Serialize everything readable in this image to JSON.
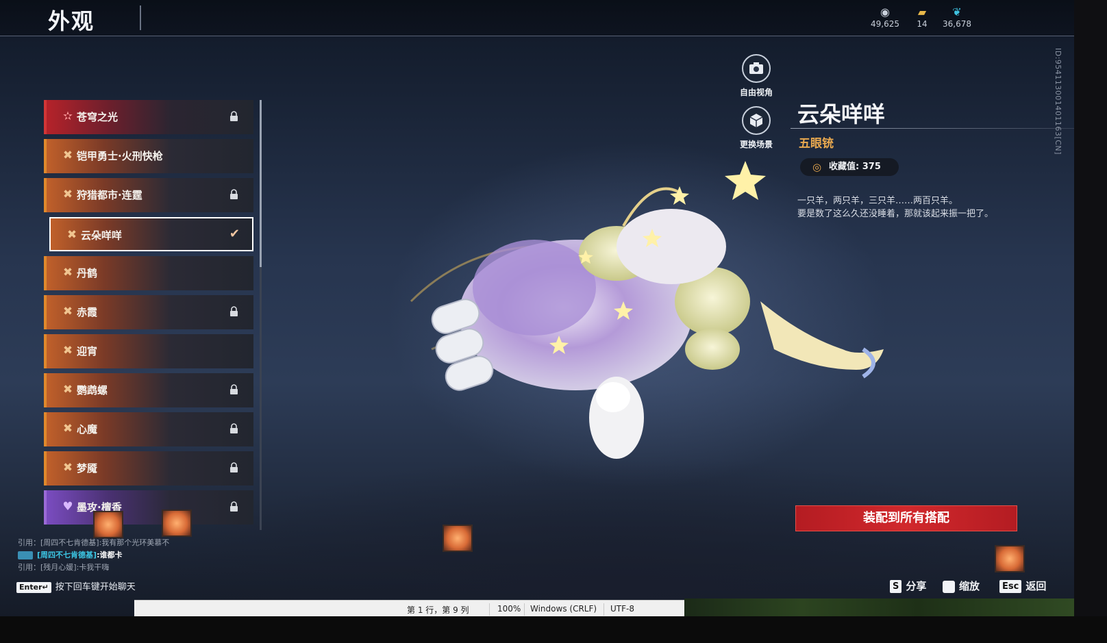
{
  "header": {
    "title": "外观",
    "currencies": [
      {
        "icon": "coin-stack-icon",
        "value": "49,625"
      },
      {
        "icon": "ticket-icon",
        "value": "14"
      },
      {
        "icon": "feather-icon",
        "value": "36,678"
      }
    ],
    "id_text": "ID:954113001401163[CN]"
  },
  "skin_list": [
    {
      "label": "苍穹之光",
      "rarity": "red",
      "locked": true,
      "selected": false
    },
    {
      "label": "铠甲勇士·火刑快枪",
      "rarity": "orange",
      "locked": false,
      "selected": false
    },
    {
      "label": "狩猎都市·连霆",
      "rarity": "orange",
      "locked": true,
      "selected": false
    },
    {
      "label": "云朵咩咩",
      "rarity": "orange",
      "locked": false,
      "selected": true
    },
    {
      "label": "丹鹤",
      "rarity": "orange",
      "locked": false,
      "selected": false
    },
    {
      "label": "赤霞",
      "rarity": "orange",
      "locked": true,
      "selected": false
    },
    {
      "label": "迎宵",
      "rarity": "orange",
      "locked": false,
      "selected": false
    },
    {
      "label": "鹦鹉螺",
      "rarity": "orange",
      "locked": true,
      "selected": false
    },
    {
      "label": "心魔",
      "rarity": "orange",
      "locked": true,
      "selected": false
    },
    {
      "label": "梦魇",
      "rarity": "orange",
      "locked": true,
      "selected": false
    },
    {
      "label": "墨攻·檀香",
      "rarity": "purple",
      "locked": true,
      "selected": false
    }
  ],
  "view_controls": {
    "free_view": "自由视角",
    "change_scene": "更换场景"
  },
  "detail": {
    "name": "云朵咩咩",
    "weapon": "五眼铳",
    "collection_label": "收藏值: 375",
    "description_line1": "一只羊，两只羊，三只羊……两百只羊。",
    "description_line2": "要是数了这么久还没睡着，那就该起来振一把了。"
  },
  "equip_button": "装配到所有搭配",
  "chat": {
    "line1": "引用：[周四不七肯德基]:我有那个光环美慕不",
    "line2_name": "[周四不七肯德基]",
    "line2_text": ":谁都卡",
    "line3": "引用：[残月心媛]:卡我干嗨",
    "enter_key": "Enter↵",
    "enter_hint": "按下回车键开始聊天"
  },
  "hints": [
    {
      "key": "S",
      "label": "分享"
    },
    {
      "key": "",
      "label": "缩放"
    },
    {
      "key": "Esc",
      "label": "返回"
    }
  ],
  "statusbar": {
    "position": "第 1 行，第 9 列",
    "zoom": "100%",
    "line_ending": "Windows (CRLF)",
    "encoding": "UTF-8"
  },
  "colors": {
    "accent_orange": "#e0892c",
    "accent_red": "#d23636",
    "accent_purple": "#9a6ad6",
    "equip_red": "#c42126",
    "weapon_gold": "#e9a94f"
  }
}
